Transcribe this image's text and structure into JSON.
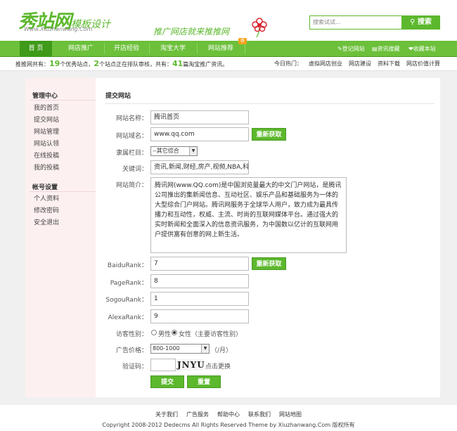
{
  "header": {
    "logo_main": "秀站网",
    "logo_sub": "模板设计",
    "logo_url": "Www.Xiuzhanwang.Com",
    "slogan": "推广网店就来推推网",
    "search_placeholder": "搜索试试...",
    "search_button": "搜索"
  },
  "nav": {
    "items": [
      "首 页",
      "网店推广",
      "开店经验",
      "淘宝大学",
      "网站推荐"
    ],
    "badge": "荐",
    "right": [
      "登记网站",
      "资讯搜藏",
      "收藏本站"
    ]
  },
  "stats": {
    "p1": "推推网共有：",
    "n1": "19",
    "p2": "个优秀站点，",
    "n2": "2",
    "p3": "个站点正在排队审核，共有：",
    "n3": "41",
    "p4": "篇淘宝推广资讯。",
    "hot_label": "今日热门：",
    "hot": [
      "虚拟网店创业",
      "网店建设",
      "资料下载",
      "网店价值计算"
    ]
  },
  "sidebar": {
    "section1": "管理中心",
    "items1": [
      "我的首页",
      "提交网站",
      "网站管理",
      "网站认领",
      "在线投稿",
      "我的投稿"
    ],
    "section2": "帐号设置",
    "items2": [
      "个人资料",
      "修改密码",
      "安全退出"
    ]
  },
  "form": {
    "title": "提交网站",
    "site_name_label": "网站名称：",
    "site_name": "腾讯首页",
    "domain_label": "网站域名：",
    "domain": "www.qq.com",
    "refetch": "重新获取",
    "category_label": "隶属栏目：",
    "category": "--其它综合",
    "keywords_label": "关键词：",
    "keywords": "资讯,新闻,财经,房产,视频,NBA,科技,",
    "intro_label": "网站简介：",
    "intro": "腾讯网(www.QQ.com)是中国浏览量最大的中文门户网站，是腾讯公司推出的集新闻信息、互动社区、娱乐产品和基础服务为一体的大型综合门户网站。腾讯网服务于全球华人用户，致力成为最具传播力和互动性，权威、主流、时尚的互联网媒体平台。通过强大的实时新闻和全面深入的信息资讯服务，为中国数以亿计的互联网用户提供富有创意的网上新生活。",
    "baidu_label": "BaiduRank：",
    "baidu": "7",
    "refetch2": "重新获取",
    "page_label": "PageRank：",
    "page": "8",
    "sogou_label": "SogouRank：",
    "sogou": "1",
    "alexa_label": "AlexaRank：",
    "alexa": "9",
    "gender_label": "访客性别：",
    "male": "男性",
    "female": "女性（主要访客性别）",
    "price_label": "广告价格：",
    "price": "800-1000",
    "price_unit": "（/月）",
    "captcha_label": "验证码：",
    "captcha": "JNYU",
    "captcha_refresh": "点击更换",
    "submit": "提交",
    "reset": "重置"
  },
  "footer": {
    "links": [
      "关于我们",
      "广告服务",
      "帮助中心",
      "联系我们",
      "网站地图"
    ],
    "copyright": "Copyright 2008-2012 Dedecms All Rights Reserved Theme by Xiuzhanwang.Com 版权所有"
  }
}
